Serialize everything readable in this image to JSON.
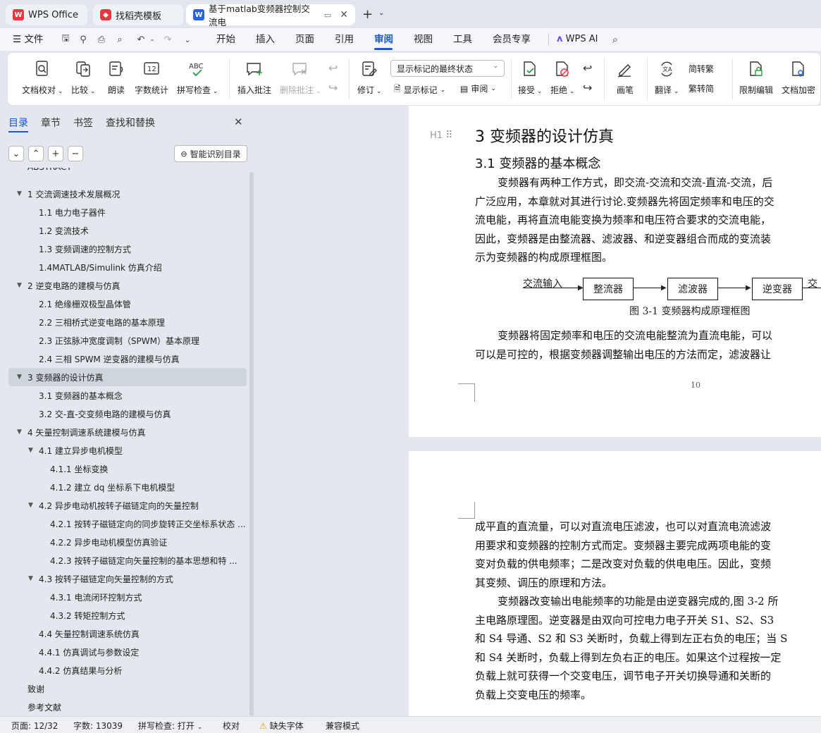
{
  "tabs": [
    {
      "label": "WPS Office"
    },
    {
      "label": "找稻壳模板"
    },
    {
      "label": "基于matlab变频器控制交流电"
    }
  ],
  "menu": {
    "file": "文件",
    "items": [
      "开始",
      "插入",
      "页面",
      "引用",
      "审阅",
      "视图",
      "工具",
      "会员专享"
    ],
    "active": "审阅",
    "wps_ai": "WPS AI"
  },
  "ribbon": {
    "doc_proof": "文档校对",
    "compare": "比较",
    "read_aloud": "朗读",
    "word_count": "字数统计",
    "spell_check": "拼写检查",
    "insert_comment": "插入批注",
    "delete_comment": "删除批注",
    "track": "修订",
    "markup_state": "显示标记的最终状态",
    "show_markup": "显示标记",
    "review": "审阅",
    "accept": "接受",
    "reject": "拒绝",
    "pen": "画笔",
    "translate": "翻译",
    "to_traditional": "简转繁",
    "to_simplified": "繁转简",
    "restrict_edit": "限制编辑",
    "encrypt": "文档加密"
  },
  "panel": {
    "tabs": [
      "目录",
      "章节",
      "书签",
      "查找和替换"
    ],
    "smart_toc": "智能识别目录"
  },
  "toc": [
    {
      "label": "ABSTRACT",
      "level": 0,
      "arrow": false
    },
    {
      "label": "1 交流调速技术发展概况",
      "level": 0,
      "arrow": true
    },
    {
      "label": "1.1 电力电子器件",
      "level": 1,
      "arrow": false
    },
    {
      "label": "1.2 变流技术",
      "level": 1,
      "arrow": false
    },
    {
      "label": "1.3 变频调速的控制方式",
      "level": 1,
      "arrow": false
    },
    {
      "label": "1.4MATLAB/Simulink 仿真介绍",
      "level": 1,
      "arrow": false
    },
    {
      "label": "2 逆变电路的建模与仿真",
      "level": 0,
      "arrow": true
    },
    {
      "label": "2.1 绝缘栅双极型晶体管",
      "level": 1,
      "arrow": false
    },
    {
      "label": "2.2 三相桥式逆变电路的基本原理",
      "level": 1,
      "arrow": false
    },
    {
      "label": "2.3 正弦脉冲宽度调制（SPWM）基本原理",
      "level": 1,
      "arrow": false
    },
    {
      "label": "2.4 三相 SPWM 逆变器的建模与仿真",
      "level": 1,
      "arrow": false
    },
    {
      "label": "3 变频器的设计仿真",
      "level": 0,
      "arrow": true,
      "selected": true
    },
    {
      "label": "3.1 变频器的基本概念",
      "level": 1,
      "arrow": false
    },
    {
      "label": "3.2 交-直-交变频电路的建模与仿真",
      "level": 1,
      "arrow": false
    },
    {
      "label": "4 矢量控制调速系统建模与仿真",
      "level": 0,
      "arrow": true
    },
    {
      "label": "4.1  建立异步电机模型",
      "level": 1,
      "arrow": true
    },
    {
      "label": "4.1.1  坐标变换",
      "level": 2,
      "arrow": false
    },
    {
      "label": "4.1.2  建立 dq 坐标系下电机模型",
      "level": 2,
      "arrow": false
    },
    {
      "label": "4.2  异步电动机按转子磁链定向的矢量控制",
      "level": 1,
      "arrow": true
    },
    {
      "label": "4.2.1 按转子磁链定向的同步旋转正交坐标系状态 ...",
      "level": 2,
      "arrow": false
    },
    {
      "label": "4.2.2  异步电动机模型仿真验证",
      "level": 2,
      "arrow": false
    },
    {
      "label": "4.2.3  按转子磁链定向矢量控制的基本思想和特 ...",
      "level": 2,
      "arrow": false
    },
    {
      "label": "4.3  按转子磁链定向矢量控制的方式",
      "level": 1,
      "arrow": true
    },
    {
      "label": "4.3.1  电流闭环控制方式",
      "level": 2,
      "arrow": false
    },
    {
      "label": "4.3.2  转矩控制方式",
      "level": 2,
      "arrow": false
    },
    {
      "label": "4.4  矢量控制调速系统仿真",
      "level": 1,
      "arrow": false
    },
    {
      "label": "4.4.1  仿真调试与参数设定",
      "level": 1,
      "arrow": false
    },
    {
      "label": "4.4.2  仿真结果与分析",
      "level": 1,
      "arrow": false
    },
    {
      "label": "致谢",
      "level": 0,
      "arrow": false
    },
    {
      "label": "参考文献",
      "level": 0,
      "arrow": false
    }
  ],
  "doc": {
    "h1_marker": "H1",
    "heading": "3 变频器的设计仿真",
    "subheading": "3.1 变频器的基本概念",
    "para1": [
      "变频器有两种工作方式，即交流-交流和交流-直流-交流，后",
      "广泛应用，本章就对其进行讨论.变频器先将固定频率和电压的交",
      "流电能，再将直流电能变换为频率和电压符合要求的交流电能，",
      "因此，变频器是由整流器、滤波器、和逆变器组合而成的变流装",
      "示为变频器的构成原理框图。"
    ],
    "diagram": {
      "input_label": "交流输入",
      "boxes": [
        "整流器",
        "滤波器",
        "逆变器"
      ],
      "output_label": "交",
      "caption": "图 3-1  变频器构成原理框图"
    },
    "para2": [
      "变频器将固定频率和电压的交流电能整流为直流电能，可以",
      "可以是可控的，根据变频器调整输出电压的方法而定，滤波器让"
    ],
    "page_number": "10",
    "page2_lines": [
      "成平直的直流量，可以对直流电压滤波，也可以对直流电流滤波",
      "用要求和变频器的控制方式而定。变频器主要完成两项电能的变",
      "变对负载的供电频率；二是改变对负载的供电电压。因此，变频",
      "其变频、调压的原理和方法。",
      "变频器改变输出电能频率的功能是由逆变器完成的,图 3-2 所",
      "主电路原理图。逆变器是由双向可控电力电子开关 S1、S2、S3",
      "和 S4 导通、S2 和 S3 关断时，负载上得到左正右负的电压；当 S",
      "和 S4 关断时，负载上得到左负右正的电压。如果这个过程按一定",
      "负载上就可获得一个交变电压，调节电子开关切换导通和关断的",
      "负载上交变电压的频率。"
    ]
  },
  "status": {
    "page": "页面: 12/32",
    "words": "字数: 13039",
    "spell": "拼写检查: 打开",
    "proof": "校对",
    "missing_font": "缺失字体",
    "compat": "兼容模式"
  },
  "colors": {
    "accent": "#1a56d6",
    "wps_red": "#e8383d"
  }
}
